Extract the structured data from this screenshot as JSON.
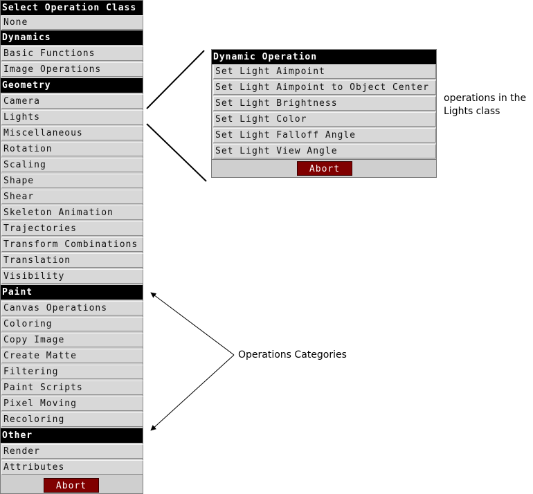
{
  "left_panel": {
    "title": "Select Operation Class",
    "groups": [
      {
        "header": "",
        "items": [
          "None"
        ]
      },
      {
        "header": "Dynamics",
        "items": [
          "Basic Functions",
          "Image Operations"
        ]
      },
      {
        "header": "Geometry",
        "items": [
          "Camera",
          "Lights",
          "Miscellaneous",
          "Rotation",
          "Scaling",
          "Shape",
          "Shear",
          "Skeleton Animation",
          "Trajectories",
          "Transform Combinations",
          "Translation",
          "Visibility"
        ]
      },
      {
        "header": "Paint",
        "items": [
          "Canvas Operations",
          "Coloring",
          "Copy Image",
          "Create Matte",
          "Filtering",
          "Paint Scripts",
          "Pixel Moving",
          "Recoloring"
        ]
      },
      {
        "header": "Other",
        "items": [
          "Render",
          "Attributes"
        ]
      }
    ],
    "abort_label": "Abort"
  },
  "right_panel": {
    "title": "Dynamic Operation",
    "items": [
      "Set Light Aimpoint",
      "Set Light Aimpoint to Object Center",
      "Set Light Brightness",
      "Set Light Color",
      "Set Light Falloff Angle",
      "Set Light View Angle"
    ],
    "abort_label": "Abort"
  },
  "annotations": {
    "lights_class_line1": "operations in the",
    "lights_class_line2": "Lights class",
    "categories": "Operations Categories"
  },
  "colors": {
    "header_bg": "#000000",
    "abort_bg": "#800000",
    "panel_bg": "#cfcfcf"
  }
}
